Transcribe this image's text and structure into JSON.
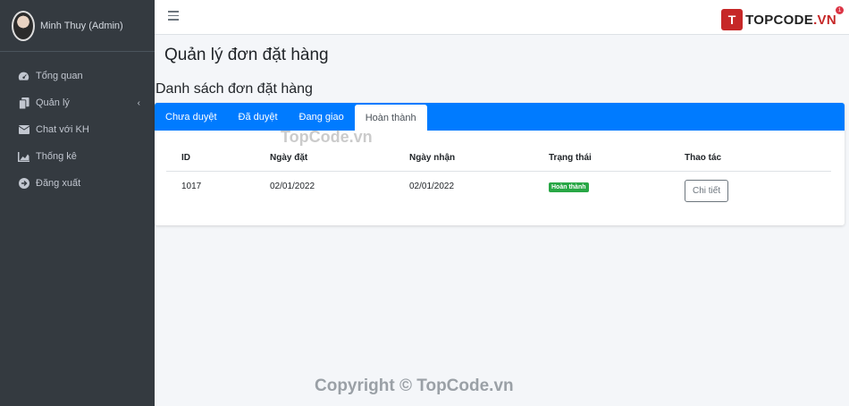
{
  "user": {
    "name": "Minh Thuy (Admin)"
  },
  "sidebar": {
    "items": [
      {
        "label": "Tổng quan",
        "icon": "dashboard-icon"
      },
      {
        "label": "Quản lý",
        "icon": "copy-icon",
        "chevron": "‹"
      },
      {
        "label": "Chat với KH",
        "icon": "envelope-icon"
      },
      {
        "label": "Thống kê",
        "icon": "chart-area-icon"
      },
      {
        "label": "Đăng xuất",
        "icon": "sign-out-icon"
      }
    ]
  },
  "brand": {
    "mark": "T",
    "name": "TOPCODE",
    "tld": ".VN",
    "badge": "1"
  },
  "page": {
    "title": "Quản lý đơn đặt hàng",
    "section_title": "Danh sách đơn đặt hàng"
  },
  "tabs": [
    "Chưa duyệt",
    "Đã duyệt",
    "Đang giao",
    "Hoàn thành"
  ],
  "table": {
    "headers": [
      "ID",
      "Ngày đặt",
      "Ngày nhận",
      "Trạng thái",
      "Thao tác"
    ],
    "rows": [
      {
        "id": "1017",
        "order_date": "02/01/2022",
        "receive_date": "02/01/2022",
        "status": "Hoàn thành",
        "action": "Chi tiết"
      }
    ]
  },
  "watermark": "TopCode.vn",
  "copyright": "Copyright © TopCode.vn",
  "colors": {
    "primary": "#007bff",
    "sidebar": "#343a40",
    "success": "#28a745",
    "brand_red": "#c62828"
  }
}
